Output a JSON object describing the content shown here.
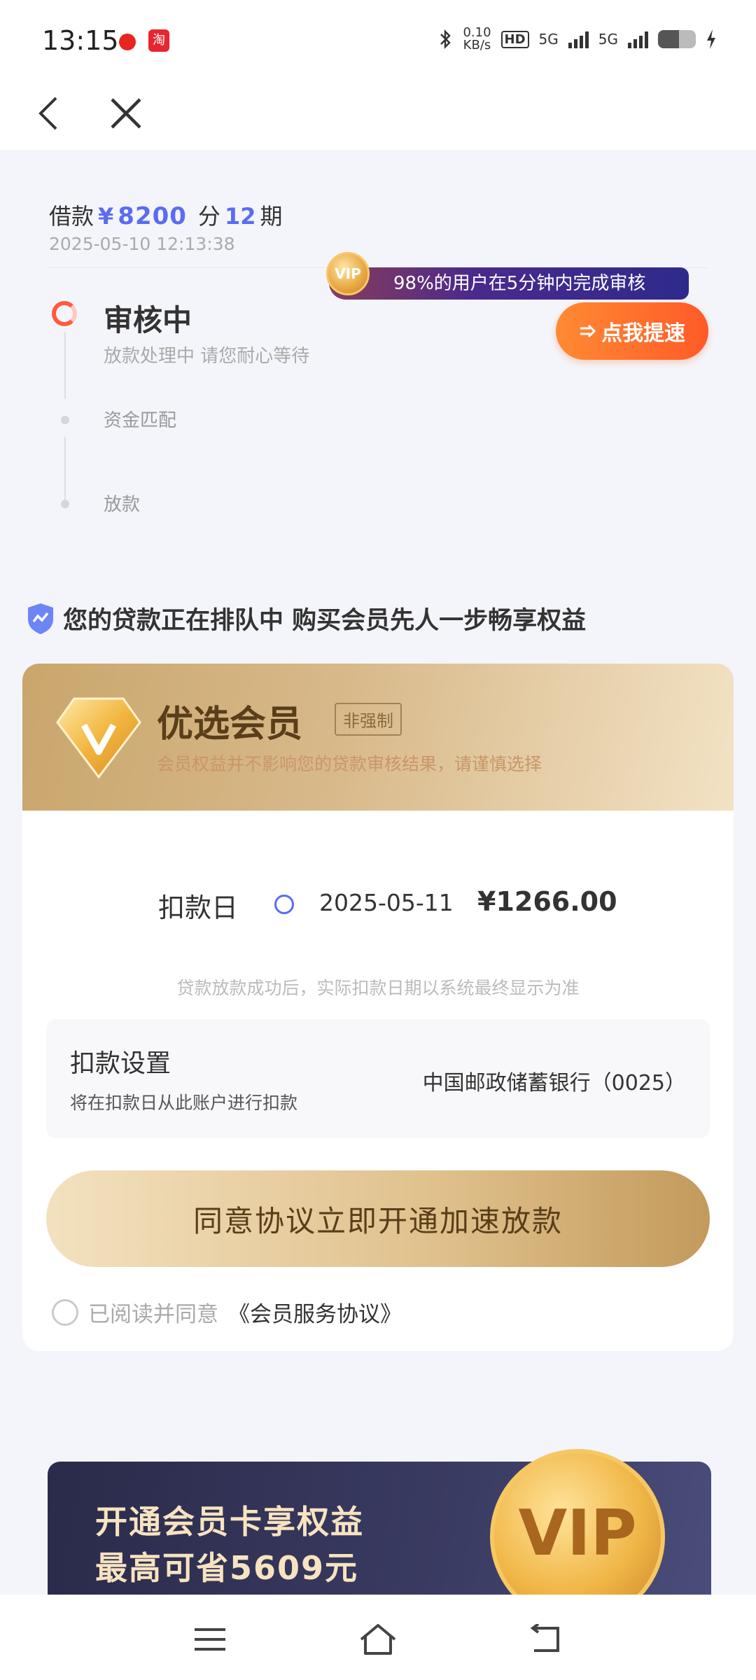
{
  "status_bar": {
    "time": "13:15",
    "net_speed_value": "0.10",
    "net_speed_unit": "KB/s",
    "hd_label": "HD",
    "signal1": "5G",
    "signal2": "5G",
    "battery_level": 0.55,
    "icons": [
      "app-red-dot-icon",
      "taobao-app-icon",
      "bluetooth-icon",
      "hd-icon",
      "signal-icon",
      "battery-icon",
      "charging-icon"
    ]
  },
  "nav": {
    "icons": [
      "back-arrow-icon",
      "close-icon"
    ]
  },
  "loan": {
    "prefix": "借款",
    "currency": "¥",
    "amount": "8200",
    "split": "分",
    "periods": "12",
    "period_unit": "期",
    "datetime": "2025-05-10 12:13:38"
  },
  "tip": {
    "coin_label": "VIP",
    "text": "98%的用户在5分钟内完成审核"
  },
  "speed_button": {
    "icon": "speed-arrow-icon",
    "label": "点我提速"
  },
  "steps": [
    {
      "title": "审核中",
      "sub": "放款处理中 请您耐心等待",
      "state": "active"
    },
    {
      "title": "资金匹配",
      "state": "pending"
    },
    {
      "title": "放款",
      "state": "pending"
    }
  ],
  "member_header": {
    "icon": "shield-check-icon",
    "text": "您的贷款正在排队中 购买会员先人一步畅享权益"
  },
  "card": {
    "title": "优选会员",
    "badge": "非强制",
    "desc": "会员权益并不影响您的贷款审核结果，请谨慎选择",
    "deduct_label": "扣款日",
    "deduct_date": "2025-05-11",
    "deduct_amount": "¥1266.00",
    "deduct_note": "贷款放款成功后，实际扣款日期以系统最终显示为准",
    "setting_title": "扣款设置",
    "setting_sub": "将在扣款日从此账户进行扣款",
    "setting_bank": "中国邮政储蓄银行（0025）",
    "agree_button": "同意协议立即开通加速放款",
    "agree_text": "已阅读并同意",
    "agree_link": "《会员服务协议》"
  },
  "promo": {
    "line1": "开通会员卡享权益",
    "line2": "最高可省5609元",
    "coin_label": "VIP"
  },
  "bottom_nav": {
    "icons": [
      "menu-icon",
      "home-icon",
      "return-icon"
    ]
  },
  "colors": {
    "accent_blue": "#5b6cf0",
    "orange": "#ff6a2c",
    "gold": "#c9a66c"
  }
}
